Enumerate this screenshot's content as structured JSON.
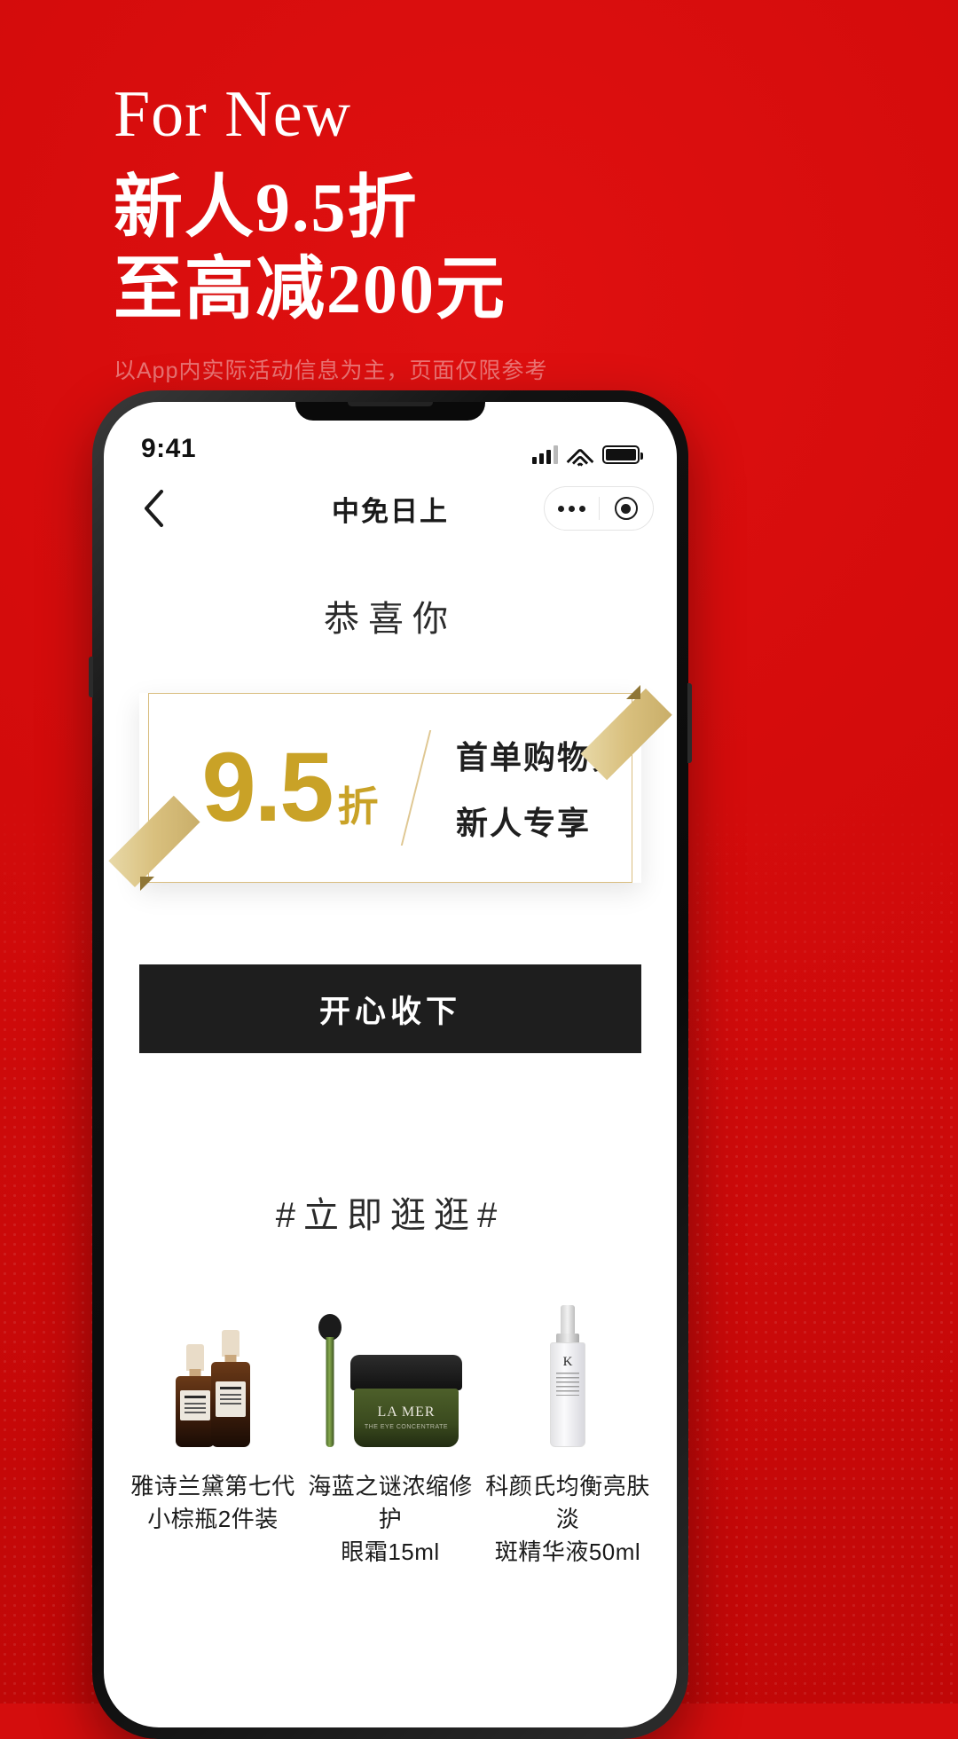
{
  "hero": {
    "eyebrow_en": "For New",
    "line1": "新人9.5折",
    "line2": "至高减200元",
    "note": "以App内实际活动信息为主，页面仅限参考"
  },
  "statusbar": {
    "time": "9:41",
    "signal_icon": "signal-bars-icon",
    "wifi_icon": "wifi-icon",
    "battery_icon": "battery-full-icon"
  },
  "navbar": {
    "back_icon": "chevron-left-icon",
    "title": "中免日上",
    "capsule": {
      "more_icon": "more-dots-icon",
      "target_icon": "target-circle-icon"
    }
  },
  "main": {
    "congrats": "恭喜你",
    "coupon": {
      "amount": "9.5",
      "unit": "折",
      "line1": "首单购物券",
      "line2": "新人专享",
      "border_color": "#d9bd7f",
      "gold_color": "#c9a227"
    },
    "cta_label": "开心收下",
    "section_title": "#立即逛逛#",
    "products": [
      {
        "name_line1": "雅诗兰黛第七代",
        "name_line2": "小棕瓶2件装",
        "image": "estee-lauder-serum-bottles"
      },
      {
        "name_line1": "海蓝之谜浓缩修护",
        "name_line2": "眼霜15ml",
        "image": "la-mer-eye-cream-jar",
        "jar_brand": "LA MER",
        "jar_sub": "THE EYE CONCENTRATE"
      },
      {
        "name_line1": "科颜氏均衡亮肤淡",
        "name_line2": "斑精华液50ml",
        "image": "kiehls-serum-dropper",
        "logo_letter": "K"
      }
    ]
  },
  "colors": {
    "background_red": "#d40d0d",
    "gold": "#c9a227",
    "gold_light": "#d9bd7f",
    "cta_black": "#1e1e1e"
  }
}
